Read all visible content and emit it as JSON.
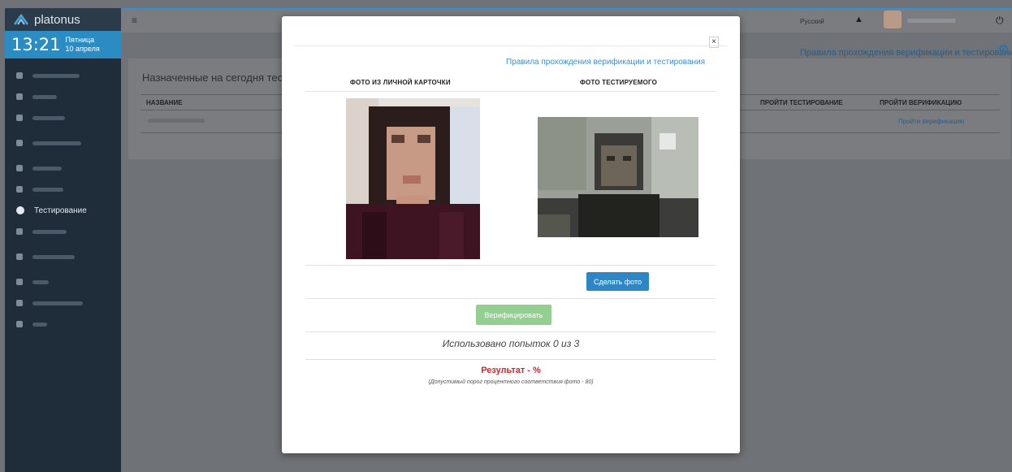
{
  "app": {
    "logo_text": "platonus"
  },
  "clock": {
    "time": "13:21",
    "weekday": "Пятница",
    "date": "10 апреля"
  },
  "sidebar": {
    "active_item": "Тестирование"
  },
  "topbar": {
    "language": "Русский"
  },
  "background": {
    "heading": "Назначенные на сегодня тесты",
    "rules_link": "Правила прохождения верификации и тестирования",
    "columns": [
      "НАЗВАНИЕ",
      "ПРОЙТИ ТЕСТИРОВАНИЕ",
      "ПРОЙТИ ВЕРИФИКАЦИЮ"
    ],
    "verify_link": "Пройти верификацию"
  },
  "modal": {
    "close": "×",
    "rules_link": "Правила прохождения верификации и тестирования",
    "col_card_photo": "ФОТО ИЗ ЛИЧНОЙ КАРТОЧКИ",
    "col_test_photo": "ФОТО ТЕСТИРУЕМОГО",
    "take_photo_button": "Сделать фото",
    "verify_button": "Верифицировать",
    "attempts": "Использовано попыток 0 из 3",
    "result": "Результат - %",
    "threshold": "(Допустимый порог процентного соответствия фото - 80)"
  },
  "colors": {
    "accent": "#2f86c7",
    "sidebar": "#1f2d3a",
    "verify_green": "#92cf91",
    "result_red": "#d7252b"
  },
  "icons": [
    "logo-icon",
    "menu-icon",
    "warning-icon",
    "power-icon",
    "gear-icon",
    "close-icon",
    "help-circle-icon"
  ]
}
